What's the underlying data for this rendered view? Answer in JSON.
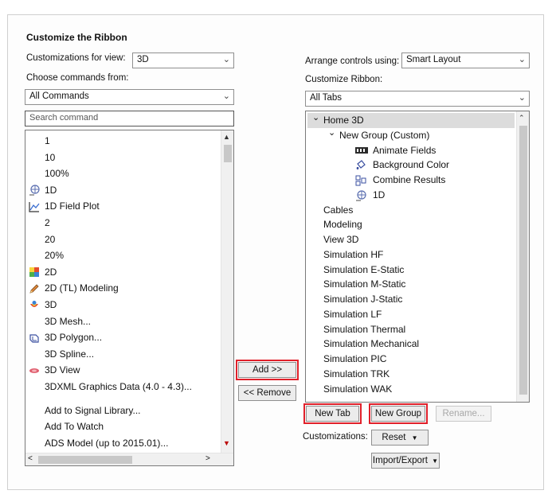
{
  "dialog": {
    "title": "Customize the Ribbon"
  },
  "left": {
    "customizations_for_label": "Customizations for view:",
    "customizations_for_value": "3D",
    "choose_label": "Choose commands from:",
    "choose_value": "All Commands",
    "search_placeholder": "Search command",
    "commands": [
      {
        "label": "1",
        "icon": ""
      },
      {
        "label": "10",
        "icon": ""
      },
      {
        "label": "100%",
        "icon": ""
      },
      {
        "label": "1D",
        "icon": "globe-plot-icon"
      },
      {
        "label": "1D Field Plot",
        "icon": "line-plot-icon"
      },
      {
        "label": "2",
        "icon": ""
      },
      {
        "label": "20",
        "icon": ""
      },
      {
        "label": "20%",
        "icon": ""
      },
      {
        "label": "2D",
        "icon": "color-map-icon"
      },
      {
        "label": "2D (TL) Modeling",
        "icon": "pencil-icon"
      },
      {
        "label": "3D",
        "icon": "shape-3d-icon"
      },
      {
        "label": "3D Mesh...",
        "icon": ""
      },
      {
        "label": "3D Polygon...",
        "icon": "polygon-icon"
      },
      {
        "label": "3D Spline...",
        "icon": ""
      },
      {
        "label": "3D View",
        "icon": "view-3d-icon"
      },
      {
        "label": "3DXML Graphics Data (4.0 - 4.3)...",
        "icon": ""
      },
      {
        "label": "Add to Signal Library...",
        "icon": ""
      },
      {
        "label": "Add To Watch",
        "icon": ""
      },
      {
        "label": "ADS Model (up to 2015.01)...",
        "icon": ""
      }
    ]
  },
  "middle": {
    "add_label": "Add >>",
    "remove_label": "<< Remove"
  },
  "right": {
    "arrange_label": "Arrange controls using:",
    "arrange_value": "Smart Layout",
    "customize_ribbon_label": "Customize Ribbon:",
    "customize_ribbon_value": "All Tabs",
    "tree": [
      {
        "label": "Home 3D",
        "level": 0,
        "toggle": "expanded",
        "icon": ""
      },
      {
        "label": "New Group (Custom)",
        "level": 1,
        "toggle": "expanded",
        "icon": ""
      },
      {
        "label": "Animate Fields",
        "level": 2,
        "toggle": "",
        "icon": "animate-fields-icon"
      },
      {
        "label": "Background Color",
        "level": 2,
        "toggle": "",
        "icon": "paint-icon"
      },
      {
        "label": "Combine Results",
        "level": 2,
        "toggle": "",
        "icon": "combine-icon"
      },
      {
        "label": "1D",
        "level": 2,
        "toggle": "",
        "icon": "globe-plot-icon"
      },
      {
        "label": "Cables",
        "level": -1,
        "toggle": "",
        "icon": ""
      },
      {
        "label": "Modeling",
        "level": -1,
        "toggle": "",
        "icon": ""
      },
      {
        "label": "View 3D",
        "level": -1,
        "toggle": "",
        "icon": ""
      },
      {
        "label": "Simulation HF",
        "level": -1,
        "toggle": "",
        "icon": ""
      },
      {
        "label": "Simulation E-Static",
        "level": -1,
        "toggle": "",
        "icon": ""
      },
      {
        "label": "Simulation M-Static",
        "level": -1,
        "toggle": "",
        "icon": ""
      },
      {
        "label": "Simulation J-Static",
        "level": -1,
        "toggle": "",
        "icon": ""
      },
      {
        "label": "Simulation LF",
        "level": -1,
        "toggle": "",
        "icon": ""
      },
      {
        "label": "Simulation Thermal",
        "level": -1,
        "toggle": "",
        "icon": ""
      },
      {
        "label": "Simulation Mechanical",
        "level": -1,
        "toggle": "",
        "icon": ""
      },
      {
        "label": "Simulation PIC",
        "level": -1,
        "toggle": "",
        "icon": ""
      },
      {
        "label": "Simulation TRK",
        "level": -1,
        "toggle": "",
        "icon": ""
      },
      {
        "label": "Simulation WAK",
        "level": -1,
        "toggle": "",
        "icon": ""
      }
    ],
    "new_tab_label": "New Tab",
    "new_group_label": "New Group",
    "rename_label": "Rename...",
    "customizations_label": "Customizations:",
    "reset_label": "Reset",
    "import_export_label": "Import/Export"
  },
  "colors": {
    "highlight": "#e0202a",
    "selection": "#dcdcdc"
  }
}
